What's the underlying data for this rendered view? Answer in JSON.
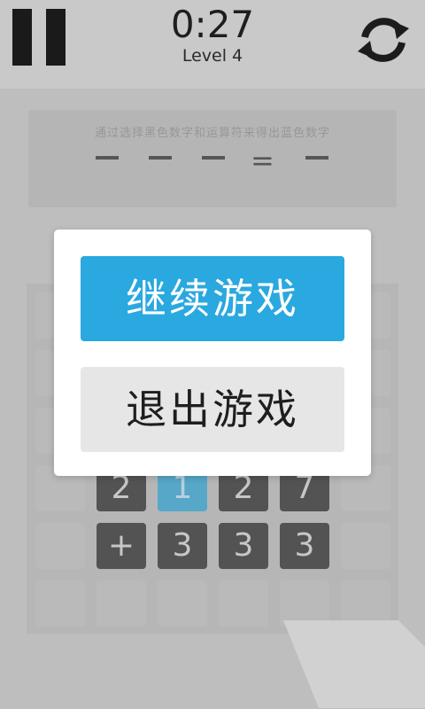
{
  "header": {
    "timer": "0:27",
    "level": "Level 4",
    "pause_icon": "pause-icon",
    "refresh_icon": "refresh-icon"
  },
  "puzzle": {
    "hint": "通过选择黑色数字和运算符来得出蓝色数字",
    "equals": "="
  },
  "board": {
    "tiles_row1": [
      "2",
      "1",
      "2",
      "7"
    ],
    "tiles_row2": [
      "+",
      "3",
      "3",
      "3"
    ],
    "selected_tile": "1"
  },
  "dialog": {
    "continue_label": "继续游戏",
    "exit_label": "退出游戏"
  },
  "colors": {
    "accent_blue": "#2aa8e0",
    "tile_dark": "#262626",
    "background": "#c9c9c9"
  }
}
